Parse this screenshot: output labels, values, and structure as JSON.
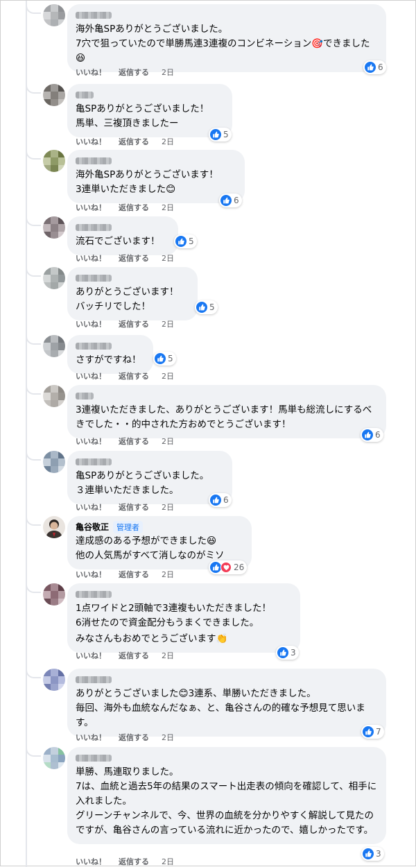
{
  "actions": {
    "like": "いいね！",
    "reply": "返信する"
  },
  "comments": [
    {
      "text": "海外亀SPありがとうございました。\n7穴で狙っていたので単勝馬連3連複のコンビネーション🎯できました😆",
      "time": "2日",
      "count": "6",
      "reactions": [
        "like-icon"
      ]
    },
    {
      "text": "亀SPありがとうございました！\n馬単、三複頂きましたー",
      "time": "2日",
      "count": "5",
      "reactions": [
        "like-icon"
      ]
    },
    {
      "text": "海外亀SPありがとうございます！\n3連単いただきました😊",
      "time": "2日",
      "count": "6",
      "reactions": [
        "like-icon"
      ]
    },
    {
      "text": "流石でございます！",
      "time": "2日",
      "count": "5",
      "reactions": [
        "like-icon"
      ]
    },
    {
      "text": "ありがとうございます！\nバッチリでした！",
      "time": "2日",
      "count": "5",
      "reactions": [
        "like-icon"
      ]
    },
    {
      "text": "さすがですね！",
      "time": "2日",
      "count": "5",
      "reactions": [
        "like-icon"
      ]
    },
    {
      "text": "3連複いただきました、ありがとうございます！馬単も総流しにするべきでした・・的中された方おめでとうございます！",
      "time": "2日",
      "count": "6",
      "reactions": [
        "like-icon"
      ]
    },
    {
      "text": "亀SPありがとうございました。\n３連単いただきました。",
      "time": "2日",
      "count": "6",
      "reactions": [
        "like-icon"
      ]
    },
    {
      "author": "亀谷敬正",
      "badge": "管理者",
      "text": "達成感のある予想ができました😆\n他の人気馬がすべて消しなのがミソ",
      "time": "2日",
      "count": "26",
      "reactions": [
        "like-icon",
        "love-icon"
      ]
    },
    {
      "text": "1点ワイドと2頭軸で3連複もいただきました！\n6消せたので資金配分もうまくできました。",
      "text2": "みなさんもおめでとうございます👏",
      "time": "2日",
      "count": "3",
      "reactions": [
        "like-icon"
      ]
    },
    {
      "text": "ありがとうございました😊3連系、単勝いただきました。\n毎回、海外も血統なんだなぁ、と、亀谷さんの的確な予想見て思います。",
      "time": "2日",
      "count": "7",
      "reactions": [
        "like-icon"
      ]
    },
    {
      "text": "単勝、馬連取りました。\n7は、血統と過去5年の結果のスマート出走表の傾向を確認して、相手に入れました。\nグリーンチャンネルで、今、世界の血統を分かりやすく解説して見たのですが、亀谷さんの言っている流れに近かったので、嬉しかったです。",
      "time": "2日",
      "count": "3",
      "reactions": [
        "like-icon"
      ]
    }
  ]
}
